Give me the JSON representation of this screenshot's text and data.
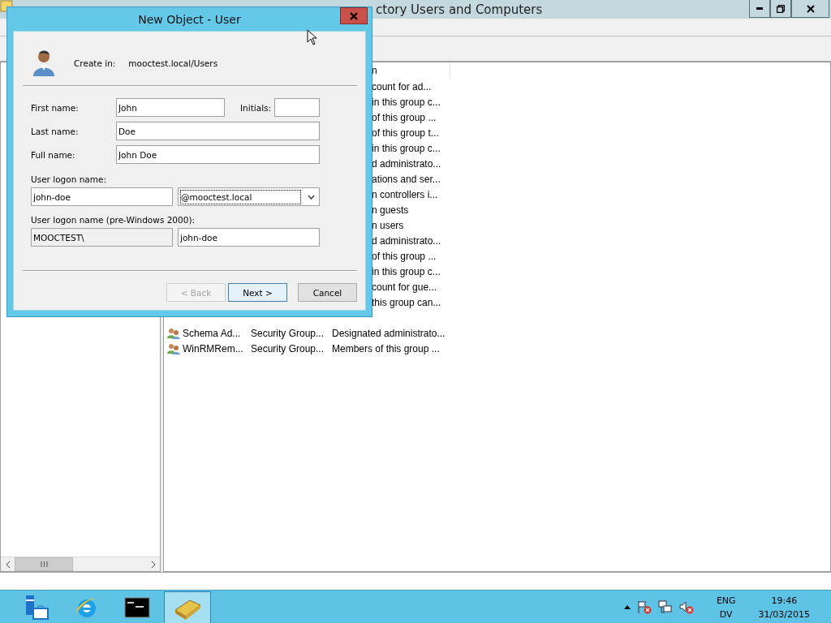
{
  "window": {
    "title": "ctory Users and Computers"
  },
  "list": {
    "header": "n",
    "rows": [
      {
        "kind": "covered",
        "description": "count for ad..."
      },
      {
        "kind": "covered",
        "description": "in this group c..."
      },
      {
        "kind": "covered",
        "description": "of this group ..."
      },
      {
        "kind": "covered",
        "description": "of this group t..."
      },
      {
        "kind": "covered",
        "description": "in this group c..."
      },
      {
        "kind": "covered",
        "description": "d administrato..."
      },
      {
        "kind": "covered",
        "description": "ations and ser..."
      },
      {
        "kind": "covered",
        "description": "n controllers i..."
      },
      {
        "kind": "covered",
        "description": "n guests"
      },
      {
        "kind": "covered",
        "description": "n users"
      },
      {
        "kind": "covered",
        "description": "d administrato..."
      },
      {
        "kind": "covered",
        "description": "of this group ..."
      },
      {
        "kind": "covered",
        "description": "in this group c..."
      },
      {
        "kind": "covered",
        "description": "count for gue..."
      },
      {
        "kind": "covered",
        "description": "this group can..."
      },
      {
        "kind": "hidden"
      },
      {
        "kind": "full",
        "name": "Schema Ad...",
        "type": "Security Group...",
        "description": "Designated administrato..."
      },
      {
        "kind": "full",
        "name": "WinRMRem...",
        "type": "Security Group...",
        "description": "Members of this group ..."
      }
    ]
  },
  "dialog": {
    "title": "New Object - User",
    "create_in_label": "Create in:",
    "create_in_value": "mooctest.local/Users",
    "first_name": {
      "label": "First name:",
      "value": "John"
    },
    "initials": {
      "label": "Initials:"
    },
    "last_name": {
      "label": "Last name:",
      "value": "Doe"
    },
    "full_name": {
      "label": "Full name:",
      "value": "John Doe"
    },
    "logon_label": "User logon name:",
    "logon_value": "john-doe",
    "domain": "@mooctest.local",
    "pre2000_label": "User logon name (pre-Windows 2000):",
    "pre2000_domain": "MOOCTEST\\",
    "pre2000_value": "john-doe",
    "buttons": [
      {
        "label": "< Back",
        "disabled": true,
        "default": false
      },
      {
        "label": "Next >",
        "disabled": false,
        "default": true
      },
      {
        "label": "Cancel",
        "disabled": false,
        "default": false
      }
    ]
  },
  "taskbar": {
    "apps": [
      {
        "kind": "server",
        "selected": false
      },
      {
        "kind": "ie",
        "selected": false
      },
      {
        "kind": "cmd",
        "selected": false
      },
      {
        "kind": "aduc",
        "selected": true
      }
    ],
    "language": "ENG",
    "layout": "DV",
    "time": "19:46",
    "date": "31/03/2015"
  }
}
